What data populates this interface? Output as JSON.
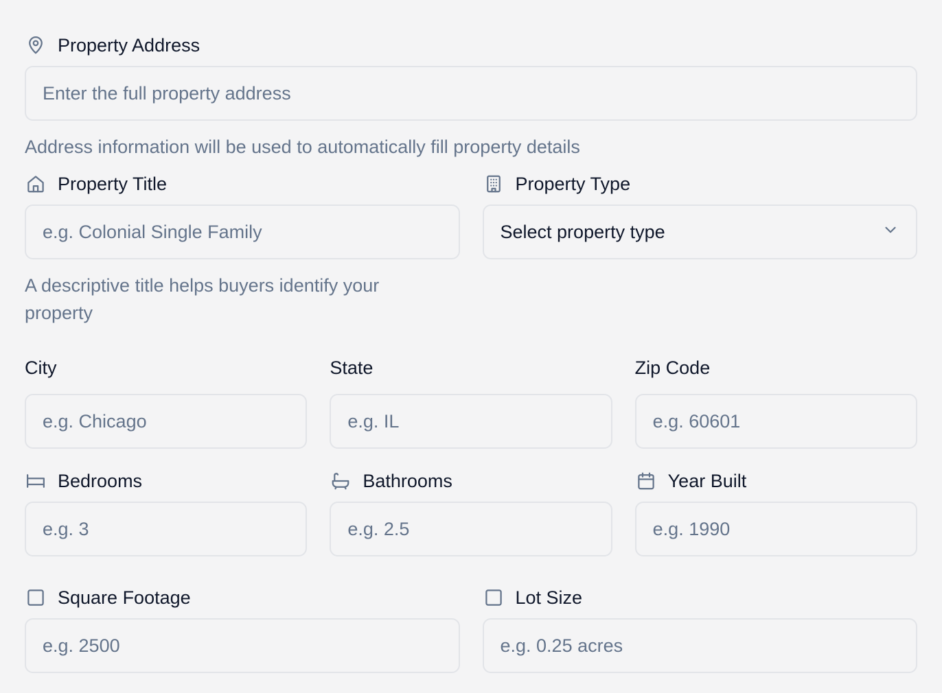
{
  "address": {
    "label": "Property Address",
    "placeholder": "Enter the full property address",
    "help": "Address information will be used to automatically fill property details"
  },
  "title": {
    "label": "Property Title",
    "placeholder": "e.g. Colonial Single Family",
    "help": "A descriptive title helps buyers identify your property"
  },
  "type": {
    "label": "Property Type",
    "value": "Select property type"
  },
  "city": {
    "label": "City",
    "placeholder": "e.g. Chicago"
  },
  "state": {
    "label": "State",
    "placeholder": "e.g. IL"
  },
  "zip": {
    "label": "Zip Code",
    "placeholder": "e.g. 60601"
  },
  "bedrooms": {
    "label": "Bedrooms",
    "placeholder": "e.g. 3"
  },
  "bathrooms": {
    "label": "Bathrooms",
    "placeholder": "e.g. 2.5"
  },
  "year_built": {
    "label": "Year Built",
    "placeholder": "e.g. 1990"
  },
  "sqft": {
    "label": "Square Footage",
    "placeholder": "e.g. 2500"
  },
  "lot": {
    "label": "Lot Size",
    "placeholder": "e.g. 0.25 acres"
  },
  "icons": {
    "address": "map-pin-icon",
    "title": "home-icon",
    "type": "building-icon",
    "bedrooms": "bed-icon",
    "bathrooms": "bath-icon",
    "year_built": "calendar-icon",
    "sqft": "square-icon",
    "lot": "square-icon",
    "select": "chevron-down-icon"
  },
  "colors": {
    "background": "#f4f4f5",
    "text": "#0f172a",
    "muted": "#64748b",
    "border": "#e2e4e8"
  }
}
